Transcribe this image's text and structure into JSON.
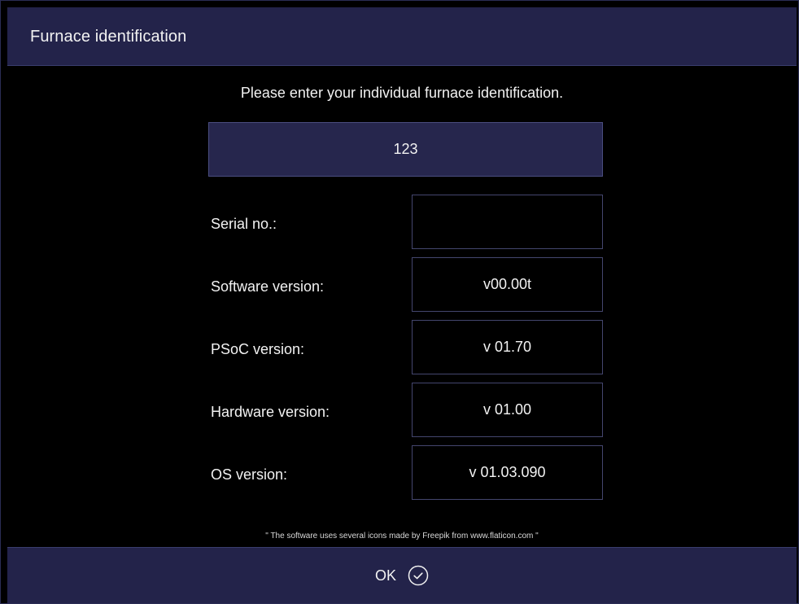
{
  "window": {
    "title": "Furnace identification"
  },
  "prompt": "Please enter your individual furnace identification.",
  "furnace_id": {
    "value": "123"
  },
  "info": [
    {
      "label": "Serial no.:",
      "value": ""
    },
    {
      "label": "Software version:",
      "value": "v00.00t"
    },
    {
      "label": "PSoC version:",
      "value": "v 01.70"
    },
    {
      "label": "Hardware version:",
      "value": "v 01.00"
    },
    {
      "label": "OS version:",
      "value": "v 01.03.090"
    }
  ],
  "credit": "\" The software uses several icons made by Freepik from www.flaticon.com \"",
  "footer": {
    "ok_label": "OK",
    "ok_icon": "check-circle-icon"
  },
  "colors": {
    "bar_background": "#23234a",
    "input_background": "#26264d",
    "page_background": "#000000",
    "border": "#44466e"
  }
}
